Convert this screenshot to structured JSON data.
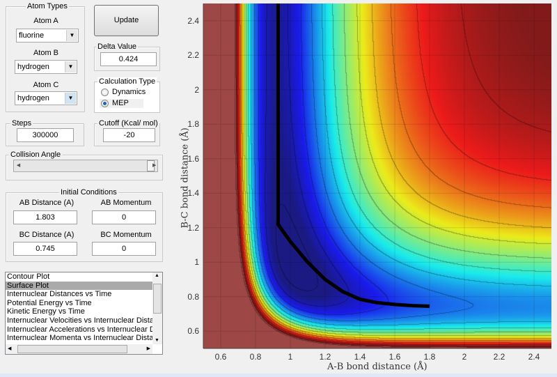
{
  "atom_types": {
    "title": "Atom Types",
    "atom_a": {
      "label": "Atom A",
      "value": "fluorine"
    },
    "atom_b": {
      "label": "Atom B",
      "value": "hydrogen"
    },
    "atom_c": {
      "label": "Atom C",
      "value": "hydrogen"
    }
  },
  "update_label": "Update",
  "delta": {
    "title": "Delta Value",
    "value": "0.424"
  },
  "calc_type": {
    "title": "Calculation Type",
    "options": [
      "Dynamics",
      "MEP"
    ],
    "selected": "MEP"
  },
  "steps": {
    "title": "Steps",
    "value": "300000"
  },
  "cutoff": {
    "title": "Cutoff (Kcal/ mol)",
    "value": "-20"
  },
  "collision_angle": {
    "title": "Collision Angle",
    "position": 0.97
  },
  "initial": {
    "title": "Initial Conditions",
    "ab_distance": {
      "label": "AB Distance (A)",
      "value": "1.803"
    },
    "ab_momentum": {
      "label": "AB Momentum",
      "value": "0"
    },
    "bc_distance": {
      "label": "BC Distance (A)",
      "value": "0.745"
    },
    "bc_momentum": {
      "label": "BC Momentum",
      "value": "0"
    }
  },
  "plot_list": {
    "items": [
      "Contour Plot",
      "Surface Plot",
      "Internuclear Distances vs Time",
      "Potential Energy vs Time",
      "Kinetic Energy vs Time",
      "Internuclear Velocities vs Internuclear Distance",
      "Internuclear Accelerations vs Internuclear Distance",
      "Internuclear Momenta vs Internuclear Distance"
    ],
    "selected": "Surface Plot"
  },
  "chart_data": {
    "type": "heatmap",
    "xlabel": "A-B bond distance (Å)",
    "ylabel": "B-C bond distance (Å)",
    "xlim": [
      0.5,
      2.5
    ],
    "ylim": [
      0.5,
      2.5
    ],
    "xticks": [
      "0.6",
      "0.8",
      "1",
      "1.2",
      "1.4",
      "1.6",
      "1.8",
      "2",
      "2.2",
      "2.4"
    ],
    "yticks": [
      "0.6",
      "0.8",
      "1",
      "1.2",
      "1.4",
      "1.6",
      "1.8",
      "2",
      "2.2",
      "2.4"
    ],
    "colormap": "jet",
    "grid": true,
    "path": {
      "x": [
        0.93,
        0.93,
        0.95,
        1.0,
        1.1,
        1.2,
        1.3,
        1.4,
        1.5,
        1.6,
        1.7,
        1.8
      ],
      "y": [
        2.5,
        1.22,
        1.19,
        1.12,
        1.0,
        0.9,
        0.83,
        0.785,
        0.765,
        0.755,
        0.748,
        0.745
      ],
      "color": "#000000"
    }
  }
}
